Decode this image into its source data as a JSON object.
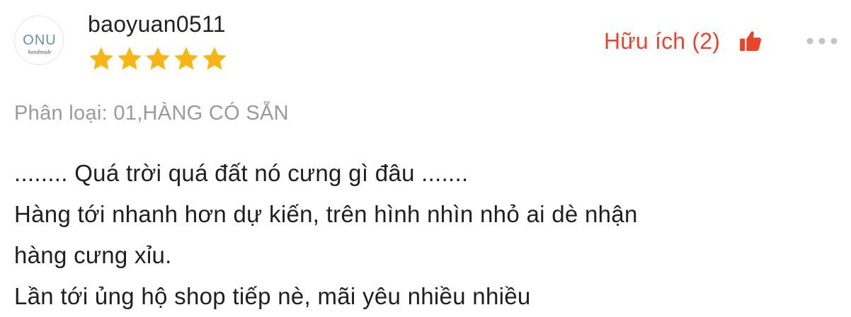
{
  "review": {
    "avatar": {
      "line1": "ONU",
      "line2": "handmade"
    },
    "username": "baoyuan0511",
    "rating": 5,
    "helpful_label": "Hữu ích (2)",
    "variation": "Phân loại: 01,HÀNG CÓ SẴN",
    "lines": [
      "........ Quá trời quá đất nó cưng gì đâu .......",
      "Hàng tới nhanh hơn dự kiến, trên hình nhìn nhỏ ai dè nhận",
      "hàng cưng xỉu.",
      "Lần tới ủng hộ shop tiếp nè, mãi yêu nhiều nhiều"
    ]
  },
  "icons": {
    "star": "star-icon",
    "thumb": "thumbs-up-icon",
    "more": "more-dots-icon"
  },
  "colors": {
    "star": "#f7b614",
    "accent": "#e8452c",
    "muted": "#9a9a9a",
    "more": "#c4c4c4",
    "avatar_text": "#6f8fa8"
  }
}
